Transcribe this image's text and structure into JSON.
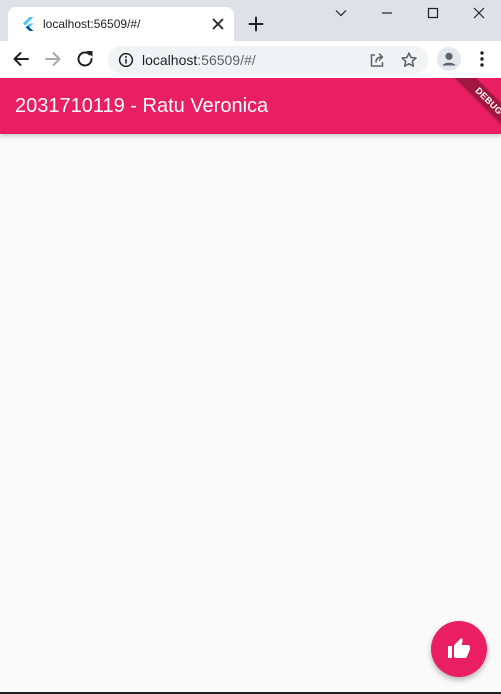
{
  "browser": {
    "tab": {
      "title": "localhost:56509/#/",
      "favicon": "flutter-icon"
    },
    "new_tab_icon": "plus-icon",
    "window_controls": [
      "chevron-down-icon",
      "minimize-icon",
      "maximize-icon",
      "close-icon"
    ],
    "omnibox": {
      "host": "localhost",
      "rest": ":56509/#/",
      "info_icon": "info-icon",
      "share_icon": "share-icon",
      "bookmark_icon": "star-icon"
    },
    "nav_icons": [
      "back-arrow-icon",
      "forward-arrow-icon",
      "reload-icon"
    ],
    "profile_icon": "profile-icon",
    "menu_icon": "kebab-menu-icon"
  },
  "app": {
    "title": "2031710119 - Ratu Veronica",
    "debug_banner": "DEBUG",
    "fab_icon": "thumb-up-icon",
    "colors": {
      "primary": "#e91e63",
      "debug_banner": "#a0183f",
      "background": "#fafafa"
    }
  }
}
